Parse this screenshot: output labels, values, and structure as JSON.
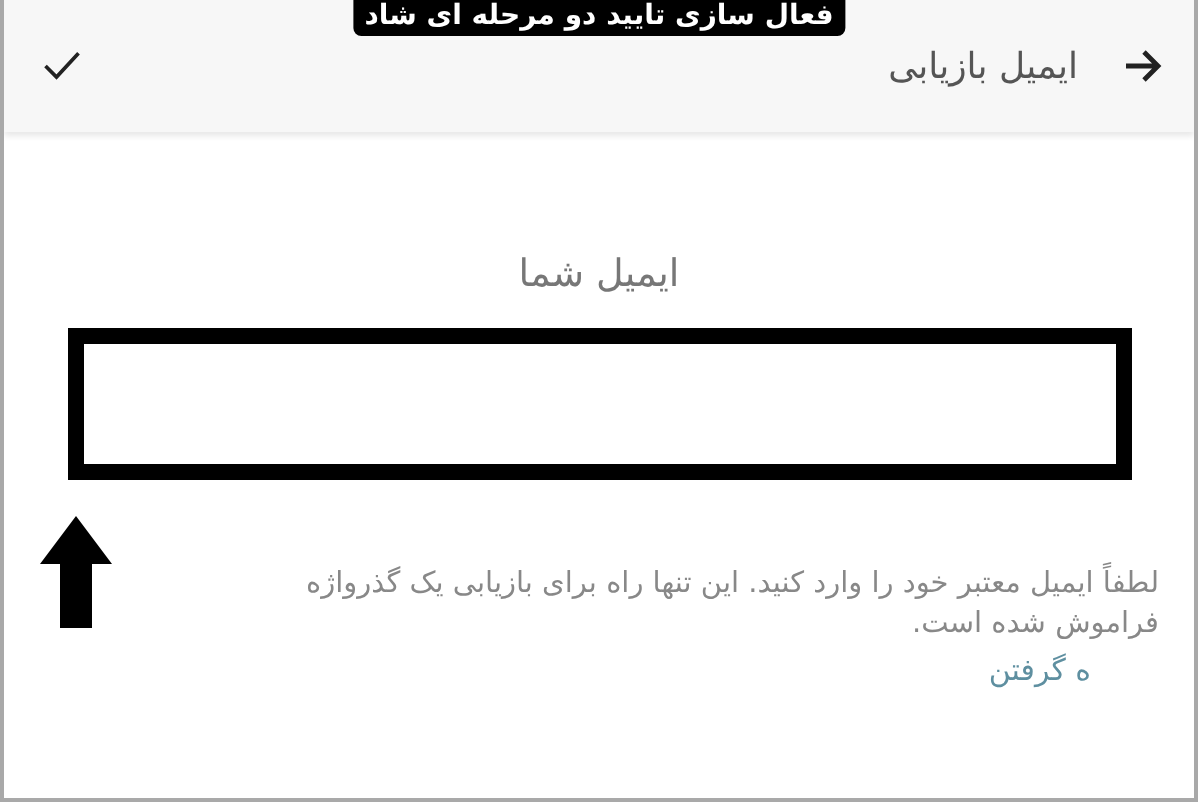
{
  "caption": "فعال سازی تایید دو مرحله ای شاد",
  "header": {
    "title": "ایمیل بازیابی"
  },
  "form": {
    "label": "ایمیل شما",
    "highlighted": true,
    "description": "لطفاً ایمیل معتبر خود را وارد کنید. این تنها راه برای بازیابی یک گذرواژه فراموش شده است.",
    "link": "ه گرفتن"
  }
}
